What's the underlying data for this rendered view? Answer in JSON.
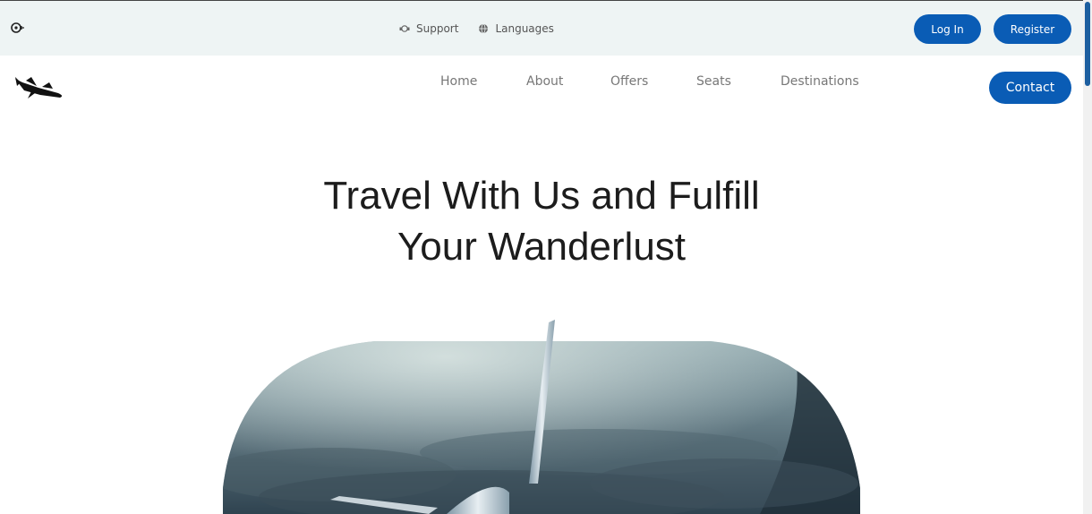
{
  "topbar": {
    "links": [
      {
        "label": "Support",
        "icon": "headset-icon"
      },
      {
        "label": "Languages",
        "icon": "globe-icon"
      }
    ],
    "login_label": "Log In",
    "register_label": "Register"
  },
  "nav": {
    "items": [
      "Home",
      "About",
      "Offers",
      "Seats",
      "Destinations"
    ],
    "contact_label": "Contact"
  },
  "hero": {
    "title_line1": "Travel With Us and Fulfill",
    "title_line2": "Your Wanderlust"
  },
  "colors": {
    "accent": "#0a5cb5",
    "topbar_bg": "#eef4f4"
  }
}
